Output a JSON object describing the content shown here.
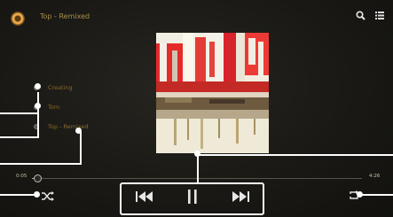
{
  "app": {
    "title": "Top - Remixed"
  },
  "toolbar": {
    "search_icon": "search-icon",
    "menu_icon": "menu-icon"
  },
  "info": {
    "items": [
      "Creating",
      "Tom",
      "Top - Remixed"
    ]
  },
  "progress": {
    "elapsed": "0:05",
    "total": "4:26",
    "fraction": 0.02
  },
  "controls": {
    "shuffle_icon": "shuffle-icon",
    "previous_icon": "skip-previous-icon",
    "pause_icon": "pause-icon",
    "next_icon": "skip-next-icon",
    "repeat_icon": "repeat-icon"
  },
  "colors": {
    "accent": "#c9a24a",
    "callout": "#ffffff",
    "background": "#1b1a16"
  }
}
